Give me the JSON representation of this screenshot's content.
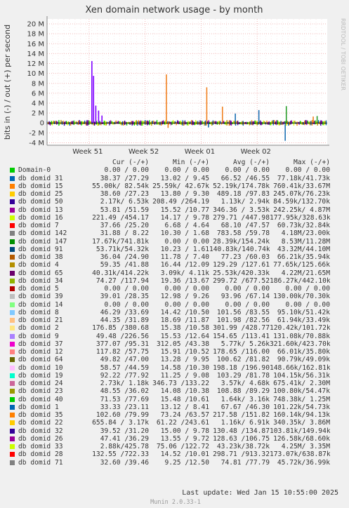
{
  "chart_data": {
    "type": "line",
    "title": "Xen domain network usage - by month",
    "ylabel": "bits in (-) / out (+) per second",
    "side_label": "RRDTOOL / TOBI OETIKER",
    "ylim": [
      -4500000,
      21000000
    ],
    "yticks": [
      {
        "value": 20000000,
        "label": "20 M"
      },
      {
        "value": 18000000,
        "label": "18 M"
      },
      {
        "value": 16000000,
        "label": "16 M"
      },
      {
        "value": 14000000,
        "label": "14 M"
      },
      {
        "value": 12000000,
        "label": "12 M"
      },
      {
        "value": 10000000,
        "label": "10 M"
      },
      {
        "value": 8000000,
        "label": "8 M"
      },
      {
        "value": 6000000,
        "label": "6 M"
      },
      {
        "value": 4000000,
        "label": "4 M"
      },
      {
        "value": 2000000,
        "label": "2 M"
      },
      {
        "value": 0,
        "label": "0"
      },
      {
        "value": -2000000,
        "label": "-2 M"
      },
      {
        "value": -4000000,
        "label": "-4 M"
      }
    ],
    "xlim": [
      0,
      35
    ],
    "xticks": [
      {
        "value": 7.5,
        "label": "Week 51"
      },
      {
        "value": 17.5,
        "label": "Week 52"
      },
      {
        "value": 27.5,
        "label": "Week 01"
      },
      {
        "value": 37.5,
        "label": "Week 02"
      }
    ],
    "grid": true,
    "spikes": [
      {
        "x": 8.0,
        "value": 12500000,
        "color": "#7f00ff"
      },
      {
        "x": 8.3,
        "value": 9500000,
        "color": "#7f00ff"
      },
      {
        "x": 8.7,
        "value": 3500000,
        "color": "#7f00ff"
      },
      {
        "x": 9.2,
        "value": 2500000,
        "color": "#7f00ff"
      },
      {
        "x": 9.8,
        "value": 1500000,
        "color": "#7f00ff"
      },
      {
        "x": 21.3,
        "value": 9800000,
        "color": "#f08020"
      },
      {
        "x": 21.6,
        "value": -1000000,
        "color": "#f08020"
      },
      {
        "x": 28.5,
        "value": 7200000,
        "color": "#f08020"
      },
      {
        "x": 28.8,
        "value": -900000,
        "color": "#1c6fb3"
      },
      {
        "x": 31.3,
        "value": 3300000,
        "color": "#f08020"
      },
      {
        "x": 33.6,
        "value": 1900000,
        "color": "#1c6fb3"
      },
      {
        "x": 37.8,
        "value": 2600000,
        "color": "#1c6fb3"
      },
      {
        "x": 42.5,
        "value": -3600000,
        "color": "#1c6fb3"
      },
      {
        "x": 42.7,
        "value": 3400000,
        "color": "#2a9d2a"
      },
      {
        "x": 47.5,
        "value": 1300000,
        "color": "#f08020"
      },
      {
        "x": 48.2,
        "value": 1400000,
        "color": "#2a9d2a"
      }
    ]
  },
  "legend": {
    "header": {
      "cur": "Cur (-/+)",
      "min": "Min (-/+)",
      "avg": "Avg (-/+)",
      "max": "Max (-/+)"
    },
    "rows": [
      {
        "name": "Domain-0",
        "color": "#00cc00",
        "cur": "0.00 / 0.00",
        "min": "0.00 / 0.00",
        "avg": "0.00 / 0.00",
        "max": "0.00 / 0.00"
      },
      {
        "name": "db domid 31",
        "color": "#0066b3",
        "cur": "38.37 /27.29",
        "min": "13.02 / 9.45",
        "avg": "66.52 /46.55",
        "max": "77.18k/41.73k"
      },
      {
        "name": "db domid 15",
        "color": "#ff8000",
        "cur": "55.00k/ 82.54k",
        "min": "25.59k/ 42.67k",
        "avg": "52.19k/174.78k",
        "max": "760.41k/33.67M"
      },
      {
        "name": "db domid 25",
        "color": "#ffcc00",
        "cur": "38.60 /27.23",
        "min": "13.80 / 9.30",
        "avg": "489.18 /97.83",
        "max": "245.07k/76.23k"
      },
      {
        "name": "db domid 50",
        "color": "#330099",
        "cur": "2.17k/ 6.53k",
        "min": "208.49 /264.19",
        "avg": "1.13k/ 2.94k",
        "max": "84.59k/132.70k"
      },
      {
        "name": "db domid 13",
        "color": "#990099",
        "cur": "53.81 /51.59",
        "min": "15.52 /10.77",
        "avg": "346.36 / 3.53k",
        "max": "242.25k/ 4.87M"
      },
      {
        "name": "db domid 16",
        "color": "#ccff00",
        "cur": "221.49 /454.17",
        "min": "14.17 / 9.78",
        "avg": "279.71 /447.98",
        "max": "177.95k/328.63k"
      },
      {
        "name": "db domid 7",
        "color": "#ff0000",
        "cur": "37.66 /25.20",
        "min": "6.68 / 4.64",
        "avg": "68.10 /47.57",
        "max": "60.73k/32.84k"
      },
      {
        "name": "db domid 142",
        "color": "#808080",
        "cur": "31.88 / 8.22",
        "min": "10.30 / 1.68",
        "avg": "783.58 /59.78",
        "max": "4.18M/23.00k"
      },
      {
        "name": "db domid 147",
        "color": "#008f00",
        "cur": "17.67k/741.81k",
        "min": "0.00 / 0.00",
        "avg": "28.39k/154.24k",
        "max": "8.53M/11.28M"
      },
      {
        "name": "db domid 91",
        "color": "#00487d",
        "cur": "53.71k/54.32k",
        "min": "10.23 / 1.61",
        "avg": "140.83k/140.74k",
        "max": "43.32M/44.10M"
      },
      {
        "name": "db domid 38",
        "color": "#b35a00",
        "cur": "36.04 /24.90",
        "min": "11.78 / 7.40",
        "avg": "77.23 /60.03",
        "max": "66.21k/35.94k"
      },
      {
        "name": "db domid 4",
        "color": "#b38f00",
        "cur": "59.35 /41.88",
        "min": "16.44 /12.09",
        "avg": "129.29 /127.61",
        "max": "77.65k/125.66k"
      },
      {
        "name": "db domid 65",
        "color": "#6b006b",
        "cur": "40.31k/414.22k",
        "min": "3.09k/ 4.11k",
        "avg": "25.53k/420.33k",
        "max": "4.22M/21.65M"
      },
      {
        "name": "db domid 34",
        "color": "#8fb300",
        "cur": "74.27 /117.94",
        "min": "19.36 /13.67",
        "avg": "299.72 /677.52",
        "max": "186.27k/442.10k"
      },
      {
        "name": "db domid 5",
        "color": "#b30000",
        "cur": "0.00 / 0.00",
        "min": "0.00 / 0.00",
        "avg": "0.00 / 0.00",
        "max": "0.00 / 0.00"
      },
      {
        "name": "db domid 39",
        "color": "#bebebe",
        "cur": "39.01 /28.35",
        "min": "12.98 / 9.26",
        "avg": "93.96 /67.14",
        "max": "130.00k/70.30k"
      },
      {
        "name": "db domid 14",
        "color": "#80ff80",
        "cur": "0.00 / 0.00",
        "min": "0.00 / 0.00",
        "avg": "0.00 / 0.00",
        "max": "0.00 / 0.00"
      },
      {
        "name": "db domid 8",
        "color": "#80c9ff",
        "cur": "46.29 /33.69",
        "min": "14.42 /10.50",
        "avg": "101.56 /83.55",
        "max": "95.10k/51.42k"
      },
      {
        "name": "db domid 21",
        "color": "#ffc080",
        "cur": "44.35 /31.89",
        "min": "18.69 /11.87",
        "avg": "101.98 /82.56",
        "max": "61.94k/33.49k"
      },
      {
        "name": "db domid 2",
        "color": "#ffe680",
        "cur": "176.85 /380.68",
        "min": "15.38 /10.58",
        "avg": "301.99 /428.77",
        "max": "120.42k/101.72k"
      },
      {
        "name": "db domid 9",
        "color": "#aa80ff",
        "cur": "49.48 /226.56",
        "min": "15.53 /12.64",
        "avg": "154.65 /113.41",
        "max": "131.08k/70.88k"
      },
      {
        "name": "db domid 37",
        "color": "#ee00cc",
        "cur": "377.07 /95.31",
        "min": "312.05 /43.38",
        "avg": "5.77k/ 5.26k",
        "max": "321.60k/423.70k"
      },
      {
        "name": "db domid 12",
        "color": "#ff8080",
        "cur": "117.82 /57.75",
        "min": "15.91 /10.52",
        "avg": "178.65 /116.00",
        "max": "66.01k/35.80k"
      },
      {
        "name": "db domid 64",
        "color": "#666600",
        "cur": "49.82 /47.00",
        "min": "13.28 / 9.95",
        "avg": "100.62 /81.82",
        "max": "90.79k/49.09k"
      },
      {
        "name": "db domid 10",
        "color": "#ffbfff",
        "cur": "58.57 /44.59",
        "min": "14.58 /10.30",
        "avg": "198.18 /196.90",
        "max": "148.66k/162.81k"
      },
      {
        "name": "db domid 19",
        "color": "#00ffcc",
        "cur": "92.22 /77.92",
        "min": "11.25 / 9.08",
        "avg": "103.29 /81.78",
        "max": "104.15k/56.31k"
      },
      {
        "name": "db domid 24",
        "color": "#cc6699",
        "cur": "2.73k/ 1.18k",
        "min": "346.73 /133.22",
        "avg": "3.57k/ 4.68k",
        "max": "675.41k/ 2.30M"
      },
      {
        "name": "db domid 23",
        "color": "#999900",
        "cur": "48.55 /36.02",
        "min": "14.08 /10.38",
        "avg": "108.88 /89.29",
        "max": "100.80k/54.47k"
      },
      {
        "name": "db domid 40",
        "color": "#00cc00",
        "cur": "71.53 /77.69",
        "min": "15.48 /10.61",
        "avg": "1.64k/ 3.16k",
        "max": "748.38k/ 1.25M"
      },
      {
        "name": "db domid 1",
        "color": "#0066b3",
        "cur": "33.33 /23.11",
        "min": "13.12 / 8.41",
        "avg": "67.67 /46.30",
        "max": "101.22k/54.73k"
      },
      {
        "name": "db domid 35",
        "color": "#ff8000",
        "cur": "102.60 /79.99",
        "min": "73.24 /63.57",
        "avg": "217.58 /151.82",
        "max": "160.14k/94.13k"
      },
      {
        "name": "db domid 22",
        "color": "#ffcc00",
        "cur": "655.84 / 3.17k",
        "min": "61.22 /243.61",
        "avg": "1.16k/ 6.91k",
        "max": "340.35k/ 3.86M"
      },
      {
        "name": "db domid 32",
        "color": "#330099",
        "cur": "39.52 /31.20",
        "min": "15.00 / 9.78",
        "avg": "130.48 /134.87",
        "max": "103.81k/149.94k"
      },
      {
        "name": "db domid 26",
        "color": "#990099",
        "cur": "47.41 /36.29",
        "min": "13.55 / 9.72",
        "avg": "128.63 /106.75",
        "max": "126.58k/68.60k"
      },
      {
        "name": "db domid 33",
        "color": "#ccff00",
        "cur": "2.88k/425.78",
        "min": "75.06 /122.72",
        "avg": "43.23k/38.72k",
        "max": "4.25M/ 3.35M"
      },
      {
        "name": "db domid 28",
        "color": "#ff0000",
        "cur": "132.55 /722.33",
        "min": "14.52 /10.01",
        "avg": "298.71 /913.32",
        "max": "173.07k/638.87k"
      },
      {
        "name": "db domid 71",
        "color": "#808080",
        "cur": "32.60 /39.46",
        "min": "9.25 /12.50",
        "avg": "74.81 /77.79",
        "max": "45.72k/36.99k"
      }
    ]
  },
  "footer": {
    "last_update": "Last update: Wed Jan 15 10:55:00 2025",
    "version": "Munin 2.0.33-1"
  }
}
